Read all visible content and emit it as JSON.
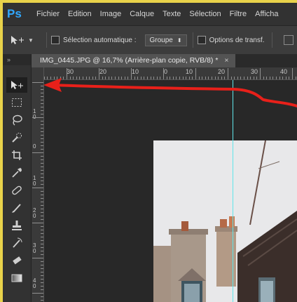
{
  "app": {
    "logo": "Ps"
  },
  "menu": [
    "Fichier",
    "Edition",
    "Image",
    "Calque",
    "Texte",
    "Sélection",
    "Filtre",
    "Afficha"
  ],
  "options_bar": {
    "auto_select_label": "Sélection automatique :",
    "auto_select_value": "Groupe",
    "transform_label": "Options de transf."
  },
  "tools_panel": {
    "collapse_glyph": "»"
  },
  "document": {
    "tab_title": "IMG_0445.JPG @ 16,7% (Arrière-plan copie, RVB/8) *",
    "close_glyph": "×"
  },
  "rulers": {
    "top_labels": [
      "30",
      "20",
      "10",
      "0",
      "10",
      "20",
      "30",
      "40"
    ],
    "left_labels": [
      "1\n0",
      "0",
      "1\n0",
      "2\n0",
      "3\n0",
      "4\n0"
    ]
  },
  "annotation": {
    "arrow_color": "#e8201a"
  },
  "colors": {
    "guide": "#5fe6ea",
    "frame_border": "#e8d24a",
    "ps_blue": "#31a8ff"
  }
}
